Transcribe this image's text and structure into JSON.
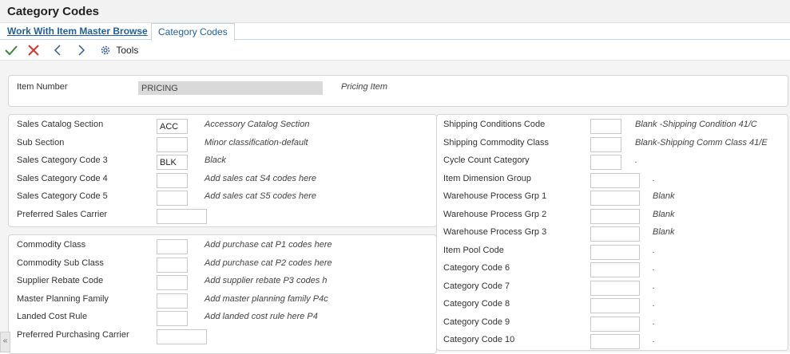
{
  "window": {
    "title": "Category Codes"
  },
  "tabs": {
    "link_label": "Work With Item Master Browse",
    "active_label": "Category Codes"
  },
  "toolbar": {
    "tools_label": "Tools"
  },
  "item": {
    "label": "Item Number",
    "value": "PRICING",
    "description": "Pricing Item"
  },
  "sales": [
    {
      "label": "Sales Catalog Section",
      "value": "ACC",
      "desc": "Accessory Catalog Section"
    },
    {
      "label": "Sub Section",
      "value": "",
      "desc": "Minor classification-default"
    },
    {
      "label": "Sales Category Code 3",
      "value": "BLK",
      "desc": "Black"
    },
    {
      "label": "Sales Category Code 4",
      "value": "",
      "desc": "Add sales cat S4 codes here"
    },
    {
      "label": "Sales Category Code 5",
      "value": "",
      "desc": "Add sales cat S5 codes here"
    },
    {
      "label": "Preferred Sales Carrier",
      "value": "",
      "desc": ""
    }
  ],
  "purchasing": [
    {
      "label": "Commodity Class",
      "value": "",
      "desc": "Add purchase cat P1 codes here"
    },
    {
      "label": "Commodity Sub Class",
      "value": "",
      "desc": "Add purchase cat P2 codes here"
    },
    {
      "label": "Supplier Rebate Code",
      "value": "",
      "desc": "Add supplier rebate P3 codes h"
    },
    {
      "label": "Master Planning Family",
      "value": "",
      "desc": "Add master planning family P4c"
    },
    {
      "label": "Landed Cost Rule",
      "value": "",
      "desc": "Add landed cost rule here P4"
    },
    {
      "label": "Preferred Purchasing Carrier",
      "value": "",
      "desc": ""
    }
  ],
  "right": [
    {
      "label": "Shipping Conditions Code",
      "value": "",
      "desc": "Blank -Shipping Condition 41/C"
    },
    {
      "label": "Shipping Commodity Class",
      "value": "",
      "desc": "Blank-Shipping Comm Class 41/E"
    },
    {
      "label": "Cycle Count Category",
      "value": "",
      "desc": "."
    },
    {
      "label": "Item Dimension Group",
      "value": "",
      "desc": "."
    },
    {
      "label": "Warehouse Process Grp 1",
      "value": "",
      "desc": "Blank"
    },
    {
      "label": "Warehouse Process Grp 2",
      "value": "",
      "desc": "Blank"
    },
    {
      "label": "Warehouse Process Grp 3",
      "value": "",
      "desc": "Blank"
    },
    {
      "label": "Item Pool Code",
      "value": "",
      "desc": "."
    },
    {
      "label": "Category Code 6",
      "value": "",
      "desc": "."
    },
    {
      "label": "Category Code 7",
      "value": "",
      "desc": "."
    },
    {
      "label": "Category Code 8",
      "value": "",
      "desc": "."
    },
    {
      "label": "Category Code 9",
      "value": "",
      "desc": "."
    },
    {
      "label": "Category Code 10",
      "value": "",
      "desc": "."
    }
  ],
  "side_toggle": {
    "label": "«"
  }
}
